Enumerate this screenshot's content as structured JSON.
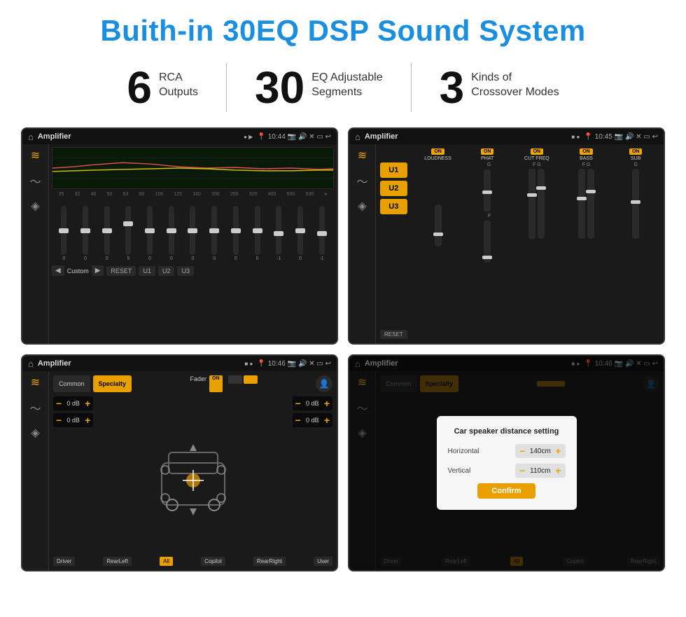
{
  "title": "Buith-in 30EQ DSP Sound System",
  "stats": [
    {
      "number": "6",
      "label": "RCA\nOutputs"
    },
    {
      "number": "30",
      "label": "EQ Adjustable\nSegments"
    },
    {
      "number": "3",
      "label": "Kinds of\nCrossover Modes"
    }
  ],
  "screens": [
    {
      "id": "screen1",
      "statusBar": {
        "title": "Amplifier",
        "time": "10:44"
      },
      "type": "eq",
      "freqLabels": [
        "25",
        "32",
        "40",
        "50",
        "63",
        "80",
        "100",
        "125",
        "160",
        "200",
        "250",
        "320",
        "400",
        "500",
        "630"
      ],
      "sliderValues": [
        "0",
        "0",
        "0",
        "5",
        "0",
        "0",
        "0",
        "0",
        "0",
        "0",
        "-1",
        "0",
        "-1"
      ],
      "presets": [
        "Custom",
        "RESET",
        "U1",
        "U2",
        "U3"
      ]
    },
    {
      "id": "screen2",
      "statusBar": {
        "title": "Amplifier",
        "time": "10:45"
      },
      "type": "amp2",
      "uButtons": [
        "U1",
        "U2",
        "U3"
      ],
      "channels": [
        {
          "label": "LOUDNESS",
          "on": true
        },
        {
          "label": "PHAT",
          "on": true
        },
        {
          "label": "CUT FREQ",
          "on": true
        },
        {
          "label": "BASS",
          "on": true
        },
        {
          "label": "SUB",
          "on": true
        }
      ],
      "resetLabel": "RESET"
    },
    {
      "id": "screen3",
      "statusBar": {
        "title": "Amplifier",
        "time": "10:46"
      },
      "type": "fader",
      "tabs": [
        "Common",
        "Specialty"
      ],
      "activeTab": "Specialty",
      "faderLabel": "Fader",
      "faderOn": "ON",
      "dbValues": [
        "0 dB",
        "0 dB",
        "0 dB",
        "0 dB"
      ],
      "buttons": [
        "Driver",
        "RearLeft",
        "All",
        "Copilot",
        "RearRight",
        "User"
      ]
    },
    {
      "id": "screen4",
      "statusBar": {
        "title": "Amplifier",
        "time": "10:46"
      },
      "type": "dialog",
      "tabs": [
        "Common",
        "Specialty"
      ],
      "activeTab": "Specialty",
      "dialog": {
        "title": "Car speaker distance setting",
        "horizontal": {
          "label": "Horizontal",
          "value": "140cm"
        },
        "vertical": {
          "label": "Vertical",
          "value": "110cm"
        },
        "confirmLabel": "Confirm"
      },
      "buttons": [
        "Driver",
        "RearLeft",
        "All",
        "Copilot",
        "RearRight"
      ]
    }
  ],
  "colors": {
    "accent": "#1a8fe0",
    "orange": "#e8a000",
    "dark": "#1a1a1a",
    "textPrimary": "#111"
  }
}
